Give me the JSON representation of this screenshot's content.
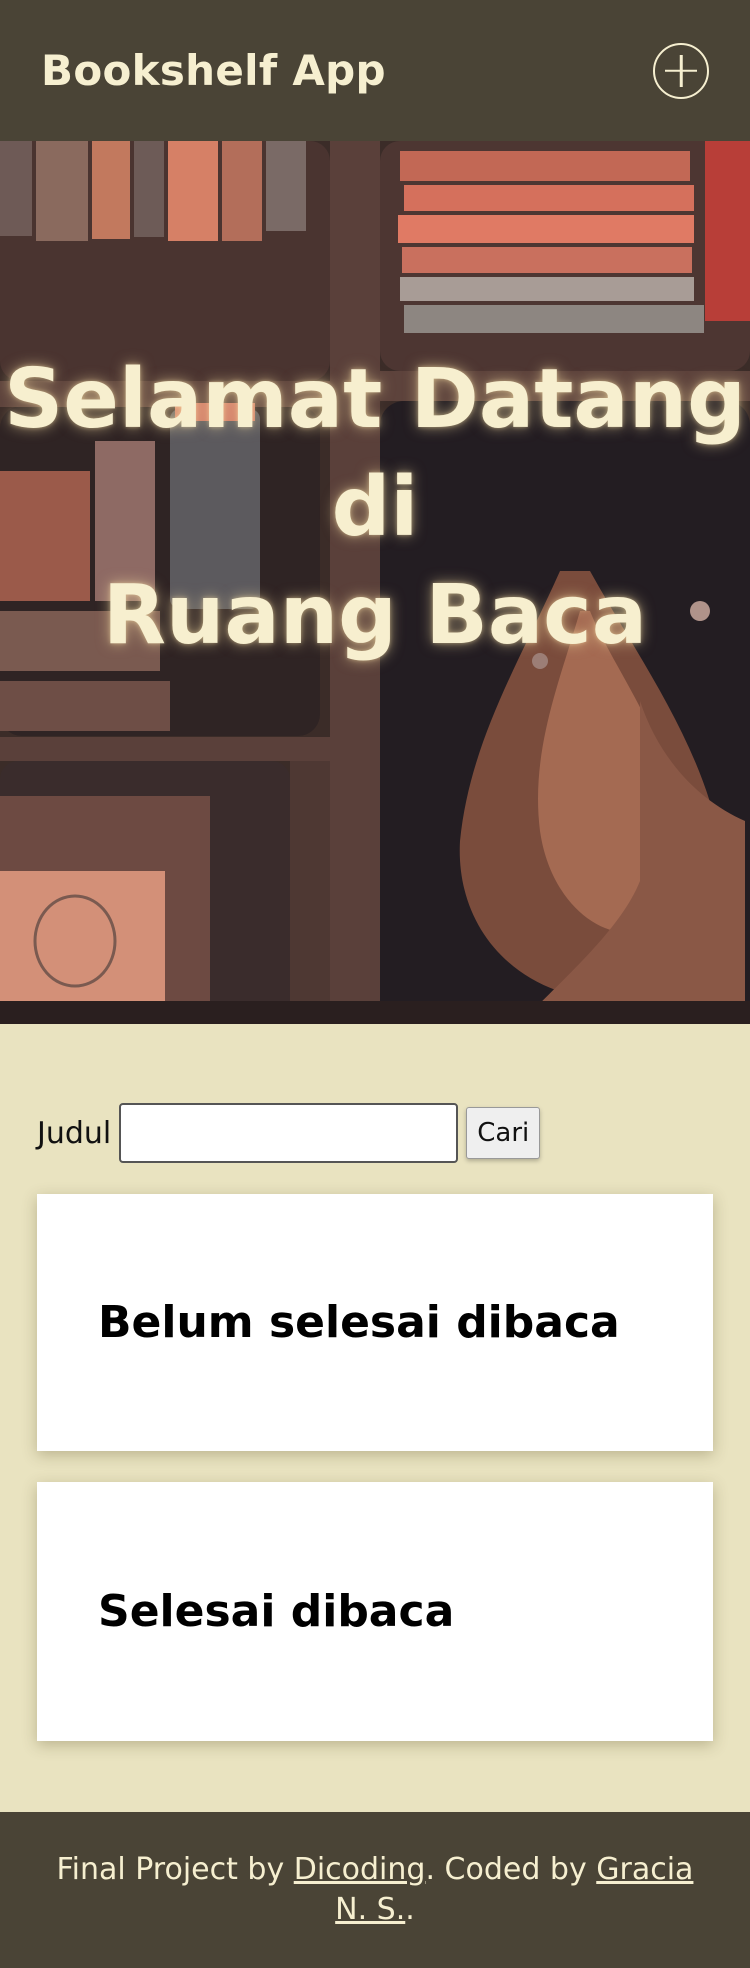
{
  "header": {
    "brand": "Bookshelf App",
    "add_icon": "plus-circle-icon"
  },
  "hero": {
    "line1": "Selamat Datang",
    "line2": "di",
    "line3": "Ruang Baca"
  },
  "search": {
    "label": "Judul",
    "value": "",
    "button": "Cari"
  },
  "shelves": {
    "unread_title": "Belum selesai dibaca",
    "read_title": "Selesai dibaca"
  },
  "footer": {
    "prefix": "Final Project by ",
    "link1": "Dicoding",
    "middle": ". Coded by ",
    "link2": "Gracia N. S.",
    "suffix": "."
  },
  "colors": {
    "header_bg": "#4a4436",
    "page_bg": "#e9e3c0",
    "accent_text": "#f6efd0"
  }
}
